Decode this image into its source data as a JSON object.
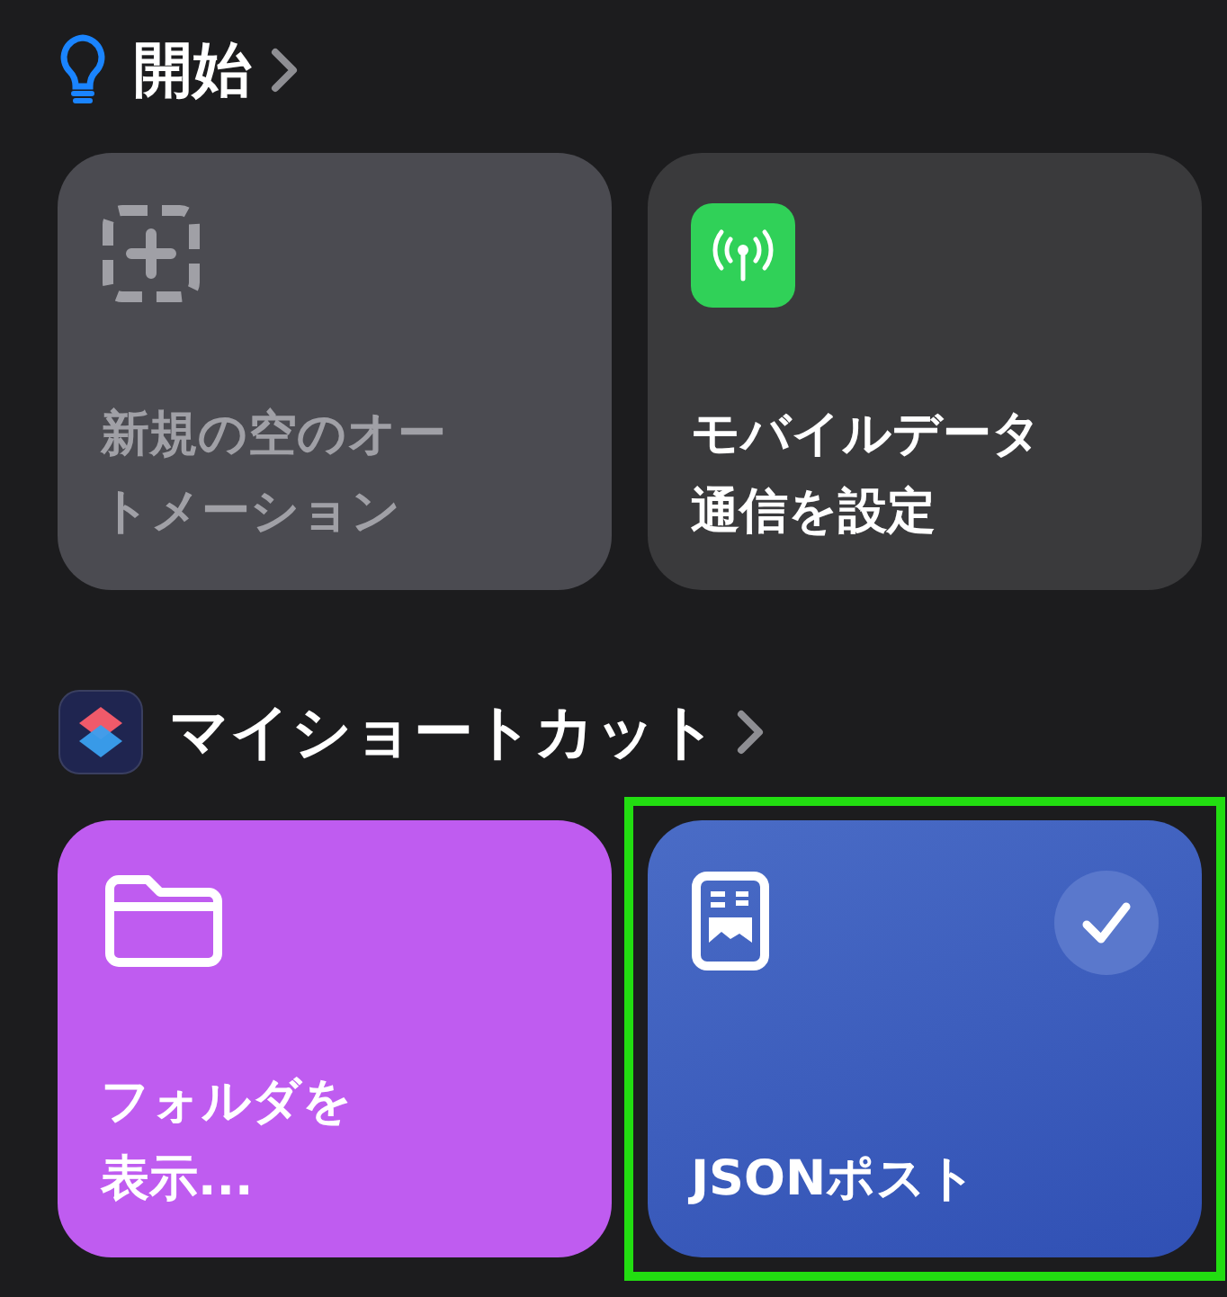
{
  "sections": [
    {
      "title": "開始",
      "cards": [
        {
          "text": "新規の空のオートメーション",
          "color": "#4b4b51",
          "dimmed": true,
          "selected": false,
          "highlighted": false
        },
        {
          "text": "モバイルデータ通信を設定",
          "color": "#3a3a3c",
          "dimmed": false,
          "selected": false,
          "highlighted": false
        }
      ]
    },
    {
      "title": "マイショートカット",
      "cards": [
        {
          "text": "フォルダを表示...",
          "color": "#bf5cf0",
          "dimmed": false,
          "selected": false,
          "highlighted": false
        },
        {
          "text": "JSONポスト",
          "color": "#3c5cbc",
          "dimmed": false,
          "selected": true,
          "highlighted": true
        }
      ]
    }
  ]
}
